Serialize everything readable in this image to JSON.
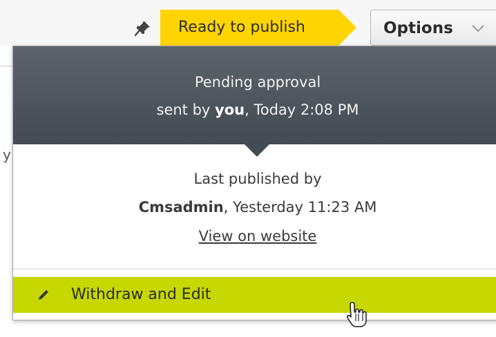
{
  "toolbar": {
    "pin_icon": "pin-icon",
    "status_badge": "Ready to publish",
    "status_color": "#ffd400",
    "options_label": "Options",
    "options_icon": "chevron-down-icon"
  },
  "popover": {
    "status_title": "Pending approval",
    "sent_prefix": "sent by ",
    "sent_by": "you",
    "sent_suffix": ", Today 2:08 PM",
    "published_label": "Last published by",
    "published_by": "Cmsadmin",
    "published_time": ", Yesterday 11:23 AM",
    "view_link": "View on website",
    "withdraw_label": "Withdraw and Edit",
    "withdraw_icon": "pencil-icon",
    "withdraw_color": "#c6d800",
    "header_color": "#4d555c"
  },
  "background": {
    "partial_letter": "y"
  }
}
